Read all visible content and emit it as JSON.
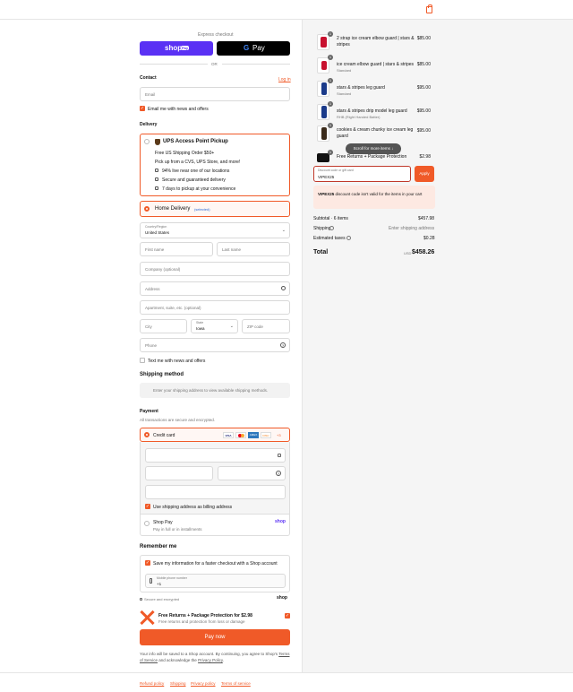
{
  "left": {
    "express_label": "Express checkout",
    "shop_pay": {
      "logo": "shop",
      "badge": "Pay"
    },
    "gpay": {
      "g": "G",
      "label": "Pay"
    },
    "or": "OR",
    "contact": {
      "title": "Contact",
      "login": "Log in",
      "email_placeholder": "Email",
      "news_label": "Email me with news and offers"
    },
    "delivery": {
      "title": "Delivery",
      "ups": {
        "title": "UPS Access Point Pickup",
        "line1": "Free US Shipping Order $50+",
        "line2": "Pick up from a CVS, UPS Store, and more!",
        "bullets": [
          "94% live near one of our locations",
          "Secure and guaranteed delivery",
          "7 days to pickup at your convenience"
        ]
      },
      "home": {
        "label": "Home Delivery",
        "selected": "(selected)"
      },
      "country_label": "Country/Region",
      "country_value": "United States",
      "first_name": "First name",
      "last_name": "Last name",
      "company": "Company (optional)",
      "address": "Address",
      "apartment": "Apartment, suite, etc. (optional)",
      "city": "City",
      "state_label": "State",
      "state_value": "Iowa",
      "zip": "ZIP code",
      "phone": "Phone",
      "text_news": "Text me with news and offers"
    },
    "shipping_method": {
      "title": "Shipping method",
      "note": "Enter your shipping address to view available shipping methods."
    },
    "payment": {
      "title": "Payment",
      "subtitle": "All transactions are secure and encrypted.",
      "credit_card": "Credit card",
      "cards": [
        "VISA",
        "MC",
        "AMEX",
        "DISC"
      ],
      "more": "+3",
      "billing_label": "Use shipping address as billing address",
      "shop_pay_title": "Shop Pay",
      "shop_pay_sub": "Pay in full or in installments",
      "shop_logo": "shop"
    },
    "remember": {
      "title": "Remember me",
      "save_label": "Save my information for a faster checkout with a Shop account",
      "mobile_label": "Mobile phone number",
      "mobile_value": "+1",
      "secure": "Secure and encrypted",
      "shop_logo": "shop"
    },
    "protection": {
      "title": "Free Returns + Package Protection for $2.98",
      "sub": "Free returns and protection from loss or damage"
    },
    "pay_now": "Pay now",
    "legal": {
      "text1": "Your info will be saved to a Shop account. By continuing, you agree to Shop's",
      "terms": "Terms of Service",
      "and": "and acknowledge the",
      "privacy": "Privacy Policy",
      "end": "."
    }
  },
  "footer": [
    "Refund policy",
    "Shipping",
    "Privacy policy",
    "Terms of service"
  ],
  "summary": {
    "items": [
      {
        "qty": "1",
        "title": "2 strap ice cream elbow guard | stars & stripes",
        "variant": "",
        "price": "$85.00"
      },
      {
        "qty": "1",
        "title": "ice cream elbow guard | stars & stripes",
        "variant": "Standard",
        "price": "$85.00"
      },
      {
        "qty": "1",
        "title": "stars & stripes leg guard",
        "variant": "Standard",
        "price": "$95.00"
      },
      {
        "qty": "1",
        "title": "stars & stripes drip model leg guard",
        "variant": "RHB (Right Handed Batter)",
        "price": "$95.00"
      },
      {
        "qty": "1",
        "title": "cookies & cream chunky ice cream leg guard",
        "variant": "Standard",
        "price": "$95.00"
      },
      {
        "qty": "1",
        "title": "Free Returns + Package Protection",
        "variant": "",
        "price": "$2.98"
      }
    ],
    "scroll_hint": "Scroll for more items",
    "discount_label": "Discount code or gift card",
    "discount_value": "VIPEX25",
    "apply": "Apply",
    "error_code": "VIPEX25",
    "error_text": "discount code isn't valid for the items in your cart",
    "subtotal_label": "Subtotal · 6 items",
    "subtotal": "$457.98",
    "shipping_label": "Shipping",
    "shipping": "Enter shipping address",
    "taxes_label": "Estimated taxes",
    "taxes": "$0.28",
    "total_label": "Total",
    "currency": "USD",
    "total": "$458.26"
  },
  "colors": {
    "accent": "#f05a28",
    "shop_purple": "#5a31f4"
  }
}
